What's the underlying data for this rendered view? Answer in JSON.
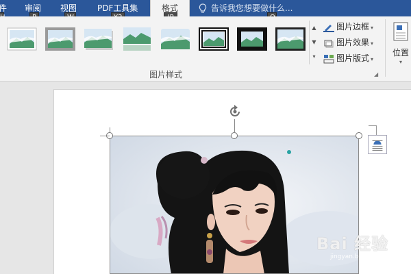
{
  "tabs": [
    {
      "label": "件",
      "keytip": "H"
    },
    {
      "label": "审阅",
      "keytip": "R"
    },
    {
      "label": "视图",
      "keytip": "W"
    },
    {
      "label": "PDF工具集",
      "keytip": "Y2"
    },
    {
      "label": "格式",
      "keytip": "JP",
      "active": true
    }
  ],
  "tell_me": {
    "text": "告诉我您想要做什么...",
    "keytip": "Q"
  },
  "picture_styles": {
    "group_label": "图片样式",
    "commands": [
      {
        "label": "图片边框",
        "icon": "picture-border-icon"
      },
      {
        "label": "图片效果",
        "icon": "picture-effects-icon"
      },
      {
        "label": "图片版式",
        "icon": "picture-layout-icon"
      }
    ]
  },
  "arrange": {
    "position_label": "位置"
  },
  "watermark": {
    "text": "Bai 经验",
    "sub": "jingyan.baidu.com"
  },
  "colors": {
    "ribbon_blue": "#2b579a",
    "ribbon_bg": "#f3f3f3",
    "doc_bg": "#e6e6e6"
  }
}
